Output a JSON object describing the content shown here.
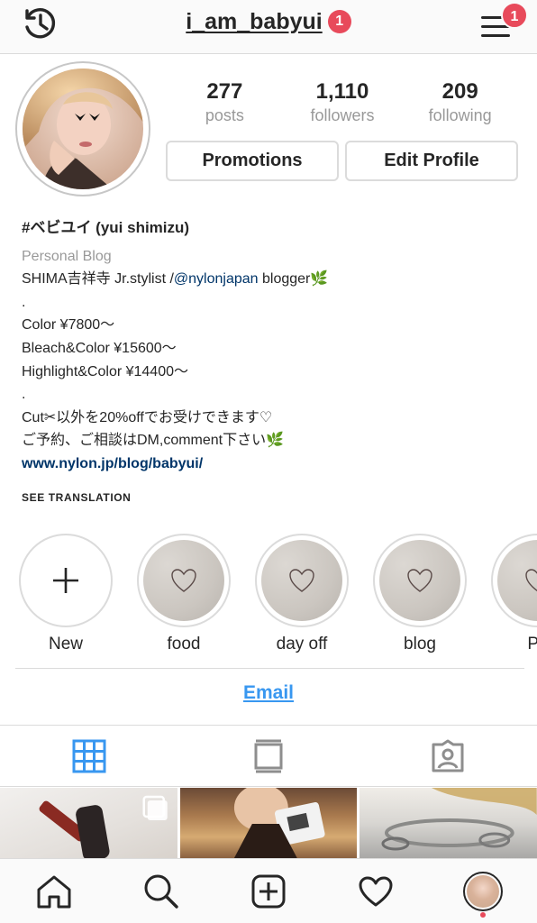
{
  "header": {
    "username": "i_am_babyui",
    "notification_count": "1",
    "menu_badge": "1"
  },
  "stats": [
    {
      "value": "277",
      "label": "posts"
    },
    {
      "value": "1,110",
      "label": "followers"
    },
    {
      "value": "209",
      "label": "following"
    }
  ],
  "buttons": {
    "promotions": "Promotions",
    "edit_profile": "Edit Profile"
  },
  "bio": {
    "name": "#ベビユイ (yui shimizu)",
    "category": "Personal Blog",
    "line1_prefix": "SHIMA吉祥寺 Jr.stylist /",
    "line1_mention": "@nylonjapan",
    "line1_suffix": " blogger🌿",
    "dot1": ".",
    "line2": "Color ¥7800〜",
    "line3": "Bleach&Color ¥15600〜",
    "line4": "Highlight&Color ¥14400〜",
    "dot2": ".",
    "line5": "Cut✂︎以外を20%offでお受けできます♡",
    "line6": "ご予約、ご相談はDM,comment下さい🌿",
    "website": "www.nylon.jp/blog/babyui/"
  },
  "see_translation": "SEE TRANSLATION",
  "highlights": [
    {
      "label": "New",
      "icon": "plus-icon"
    },
    {
      "label": "food",
      "icon": "heart-icon"
    },
    {
      "label": "day off",
      "icon": "heart-icon"
    },
    {
      "label": "blog",
      "icon": "heart-icon"
    },
    {
      "label": "Pa",
      "icon": "heart-icon"
    }
  ],
  "email": "Email",
  "tabs": [
    "grid-icon",
    "list-icon",
    "tagged-icon"
  ],
  "colors": {
    "accent_blue": "#3897f0",
    "badge_red": "#e84a5b",
    "link_navy": "#003569",
    "muted_gray": "#999999"
  },
  "bottom_nav": [
    "home-icon",
    "search-icon",
    "add-icon",
    "heart-icon",
    "profile-avatar"
  ]
}
